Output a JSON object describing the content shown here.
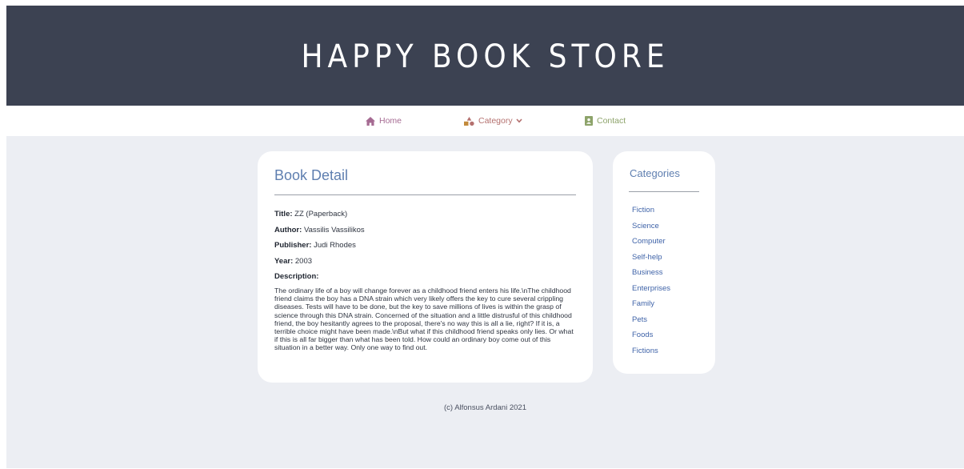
{
  "site": {
    "title": "HAPPY BOOK STORE"
  },
  "nav": {
    "home": "Home",
    "category": "Category",
    "contact": "Contact"
  },
  "book_detail": {
    "heading": "Book Detail",
    "title_label": "Title:",
    "title_value": "ZZ (Paperback)",
    "author_label": "Author:",
    "author_value": "Vassilis Vassilikos",
    "publisher_label": "Publisher:",
    "publisher_value": "Judi Rhodes",
    "year_label": "Year:",
    "year_value": "2003",
    "description_label": "Description:",
    "description": "The ordinary life of a boy will change forever as a childhood friend enters his life.\\nThe childhood friend claims the boy has a DNA strain which very likely offers the key to cure several crippling diseases. Tests will have to be done, but the key to save millions of lives is within the grasp of science through this DNA strain. Concerned of the situation and a little distrusful of this childhood friend, the boy hesitantly agrees to the proposal, there's no way this is all a lie, right? If it is, a terrible choice might have been made.\\nBut what if this childhood friend speaks only lies. Or what if this is all far bigger than what has been told. How could an ordinary boy come out of this situation in a better way. Only one way to find out."
  },
  "categories": {
    "heading": "Categories",
    "items": [
      "Fiction",
      "Science",
      "Computer",
      "Self-help",
      "Business",
      "Enterprises",
      "Family",
      "Pets",
      "Foods",
      "Fictions"
    ]
  },
  "footer": {
    "text": "(c) Alfonsus Ardani 2021"
  },
  "icons": {
    "home": "home-icon",
    "category": "shapes-icon",
    "category_caret": "chevron-down-icon",
    "contact": "contact-file-icon"
  },
  "colors": {
    "banner": "#3c4252",
    "background": "#eceef3",
    "heading_blue": "#5f7fb0",
    "link_blue": "#3f63a8",
    "home": "#a56a92",
    "category": "#b4706e",
    "contact": "#8da36a"
  }
}
